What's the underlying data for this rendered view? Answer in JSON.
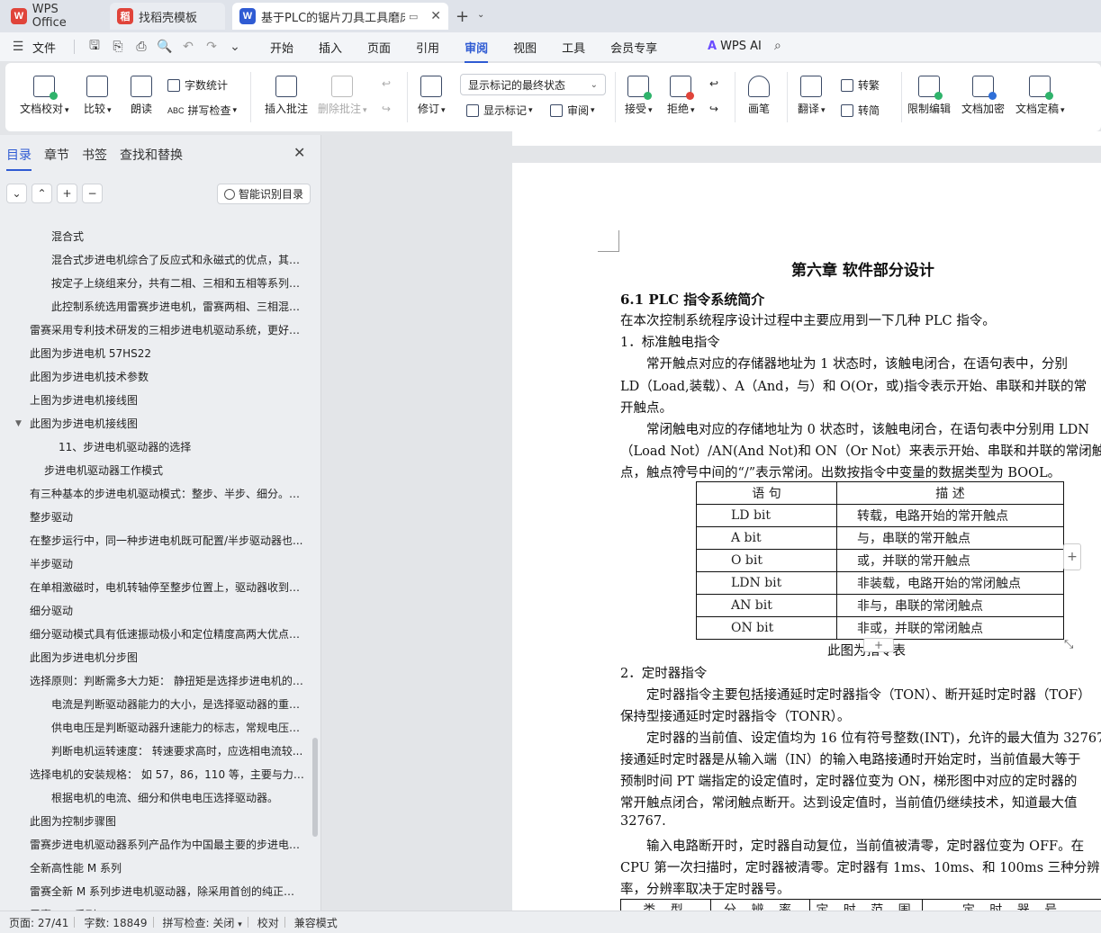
{
  "tabs": [
    {
      "label": "WPS Office",
      "logo": "W",
      "logo_color": "#e0443a"
    },
    {
      "label": "找稻壳模板",
      "logo": "稻",
      "logo_color": "#e0443a"
    },
    {
      "label": "基于PLC的锯片刀具工具磨床的",
      "logo": "W",
      "logo_color": "#2f5bd3"
    }
  ],
  "menubar": {
    "file_label": "文件",
    "items": [
      "开始",
      "插入",
      "页面",
      "引用",
      "审阅",
      "视图",
      "工具",
      "会员专享"
    ],
    "active": "审阅",
    "ai_label": "WPS AI"
  },
  "ribbon": {
    "doc_proof": "文档校对",
    "compare": "比较",
    "read_aloud": "朗读",
    "word_count": "字数统计",
    "spell_check": "拼写检查",
    "insert_comment": "插入批注",
    "delete_comment": "删除批注",
    "track": "修订",
    "markup_state": "显示标记的最终状态",
    "show_markup": "显示标记",
    "review": "审阅",
    "accept": "接受",
    "reject": "拒绝",
    "pen": "画笔",
    "translate": "翻译",
    "to_traditional": "转繁",
    "to_simplified": "转简",
    "restrict_edit": "限制编辑",
    "encrypt": "文档加密",
    "finalize": "文档定稿"
  },
  "nav": {
    "tabs": [
      "目录",
      "章节",
      "书签",
      "查找和替换"
    ],
    "active_tab": "目录",
    "smart_toc": "智能识别目录",
    "items": [
      {
        "text": "混合式",
        "level": 3
      },
      {
        "text": "混合式步进电机综合了反应式和永磁式的优点，其定子...",
        "level": 3
      },
      {
        "text": "按定子上绕组来分，共有二相、三相和五相等系列，...",
        "level": 3
      },
      {
        "text": "此控制系统选用雷赛步进电机，雷赛两相、三相混合...",
        "level": 3
      },
      {
        "text": "雷赛采用专利技术研发的三相步进电机驱动系统，更好的发...",
        "level": 1
      },
      {
        "text": "此图为步进电机 57HS22",
        "level": 1
      },
      {
        "text": "此图为步进电机技术参数",
        "level": 1
      },
      {
        "text": "上图为步进电机接线图",
        "level": 1
      },
      {
        "text": "此图为步进电机接线图",
        "level": 1,
        "caret": true
      },
      {
        "text": "11、步进电机驱动器的选择",
        "level": 4
      },
      {
        "text": "步进电机驱动器工作模式",
        "level": 2
      },
      {
        "text": "有三种基本的步进电机驱动模式：整步、半步、细分。其主...",
        "level": 1
      },
      {
        "text": "整步驱动",
        "level": 1
      },
      {
        "text": "在整步运行中，同一种步进电机既可配置/半步驱动器也...",
        "level": 1
      },
      {
        "text": "半步驱动",
        "level": 1
      },
      {
        "text": "在单相激磁时，电机转轴停至整步位置上，驱动器收到第...",
        "level": 1
      },
      {
        "text": "细分驱动",
        "level": 1
      },
      {
        "text": "细分驱动模式具有低速振动极小和定位精度高两大优点。对...",
        "level": 1
      },
      {
        "text": "此图为步进电机分步图",
        "level": 1
      },
      {
        "text": "选择原则：判断需多大力矩：  静扭矩是选择步进电机的主...",
        "level": 1
      },
      {
        "text": "电流是判断驱动器能力的大小，是选择驱动器的重要...",
        "level": 3
      },
      {
        "text": "供电电压是判断驱动器升速能力的标志，常规电压供...",
        "level": 3
      },
      {
        "text": "判断电机运转速度：  转速要求高时，应选相电流较...",
        "level": 3
      },
      {
        "text": "选择电机的安装规格：  如 57，86，110 等，主要与力矩要...",
        "level": 1
      },
      {
        "text": "根据电机的电流、细分和供电电压选择驱动器。",
        "level": 3
      },
      {
        "text": "此图为控制步骤图",
        "level": 1
      },
      {
        "text": "雷赛步进电机驱动器系列产品作为中国最主要的步进电机驱...",
        "level": 1
      },
      {
        "text": "全新高性能 M 系列",
        "level": 1
      },
      {
        "text": "雷赛全新 M 系列步进电机驱动器，除采用首创的纯正弦电...",
        "level": 1
      },
      {
        "text": "雷赛 ND 系列",
        "level": 1
      }
    ]
  },
  "document": {
    "chapter_title": "第六章  软件部分设计",
    "section_title": "6.1 PLC 指令系统简介",
    "lines": [
      "在本次控制系统程序设计过程中主要应用到一下几种 PLC 指令。",
      "1．标准触电指令",
      "　　常开触点对应的存储器地址为 1 状态时，该触电闭合，在语句表中，分别",
      "LD（Load,装载）、A（And，与）和 O(Or，或)指令表示开始、串联和并联的常",
      "开触点。",
      "　　常闭触电对应的存储地址为 0 状态时，该触电闭合，在语句表中分别用 LDN",
      "（Load Not）/AN(And Not)和 ON（Or Not）来表示开始、串联和并联的常闭触",
      "点，触点符号中间的“/”表示常闭。出数按指令中变量的数据类型为 BOOL。"
    ],
    "table_header": [
      "语  句",
      "描              述"
    ],
    "table_rows": [
      [
        "LD        bit",
        "转载，电路开始的常开触点"
      ],
      [
        "A           bit",
        "与，串联的常开触点"
      ],
      [
        "O           bit",
        "或，并联的常开触点"
      ],
      [
        "LDN      bit",
        "非装载，电路开始的常闭触点"
      ],
      [
        "AN        bit",
        "非与，串联的常闭触点"
      ],
      [
        "ON        bit",
        "非或，并联的常闭触点"
      ]
    ],
    "table_caption": "此图为指令表",
    "lines2": [
      "2．定时器指令",
      "　　定时器指令主要包括接通延时定时器指令（TON）、断开延时定时器（TOF）",
      "保持型接通延时定时器指令（TONR）。",
      "　　定时器的当前值、设定值均为 16 位有符号整数(INT)，允许的最大值为 32767",
      "接通延时定时器是从输入端（IN）的输入电路接通时开始定时，当前值最大等于",
      "预制时间 PT 端指定的设定值时，定时器位变为 ON，梯形图中对应的定时器的",
      "常开触点闭合，常闭触点断开。达到设定值时，当前值仍继续技术，知道最大值",
      "32767.",
      "　　输入电路断开时，定时器自动复位，当前值被清零，定时器位变为 OFF。在",
      "CPU 第一次扫描时，定时器被清零。定时器有 1ms、10ms、和 100ms 三种分辨",
      "率，分辨率取决于定时器号。"
    ],
    "timer_table_header": [
      "类 型",
      "分 辨 率",
      "定 时 范 围",
      "定 时 器 号"
    ]
  },
  "status": {
    "page": "页面: 27/41",
    "words": "字数: 18849",
    "spell": "拼写检查: 关闭",
    "proof": "校对",
    "compat": "兼容模式"
  }
}
